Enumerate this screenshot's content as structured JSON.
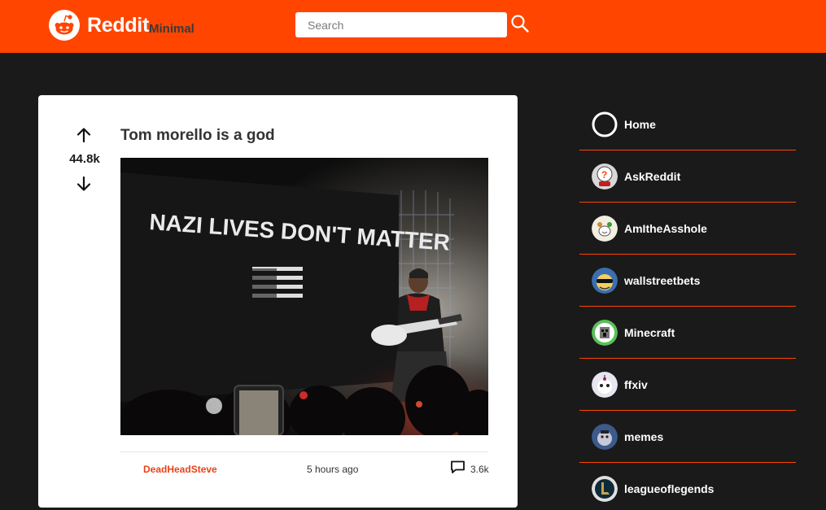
{
  "header": {
    "logo_text": "Reddit",
    "logo_subtext": "Minimal",
    "search_placeholder": "Search",
    "search_value": ""
  },
  "post": {
    "title": "Tom morello is a god",
    "votes": "44.8k",
    "image_text": "NAZI LIVES DON'T MATTER",
    "author": "DeadHeadSteve",
    "time": "5 hours ago",
    "comments": "3.6k"
  },
  "sidebar": {
    "items": [
      {
        "label": "Home",
        "icon": "home-ring-icon"
      },
      {
        "label": "AskReddit",
        "icon": "askreddit-icon"
      },
      {
        "label": "AmItheAsshole",
        "icon": "amitheasshole-icon"
      },
      {
        "label": "wallstreetbets",
        "icon": "wallstreetbets-icon"
      },
      {
        "label": "Minecraft",
        "icon": "minecraft-icon"
      },
      {
        "label": "ffxiv",
        "icon": "ffxiv-icon"
      },
      {
        "label": "memes",
        "icon": "memes-icon"
      },
      {
        "label": "leagueoflegends",
        "icon": "leagueoflegends-icon"
      }
    ]
  },
  "colors": {
    "brand": "#ff4500",
    "background": "#1a1a1a",
    "card": "#ffffff",
    "author": "#e8431a"
  }
}
